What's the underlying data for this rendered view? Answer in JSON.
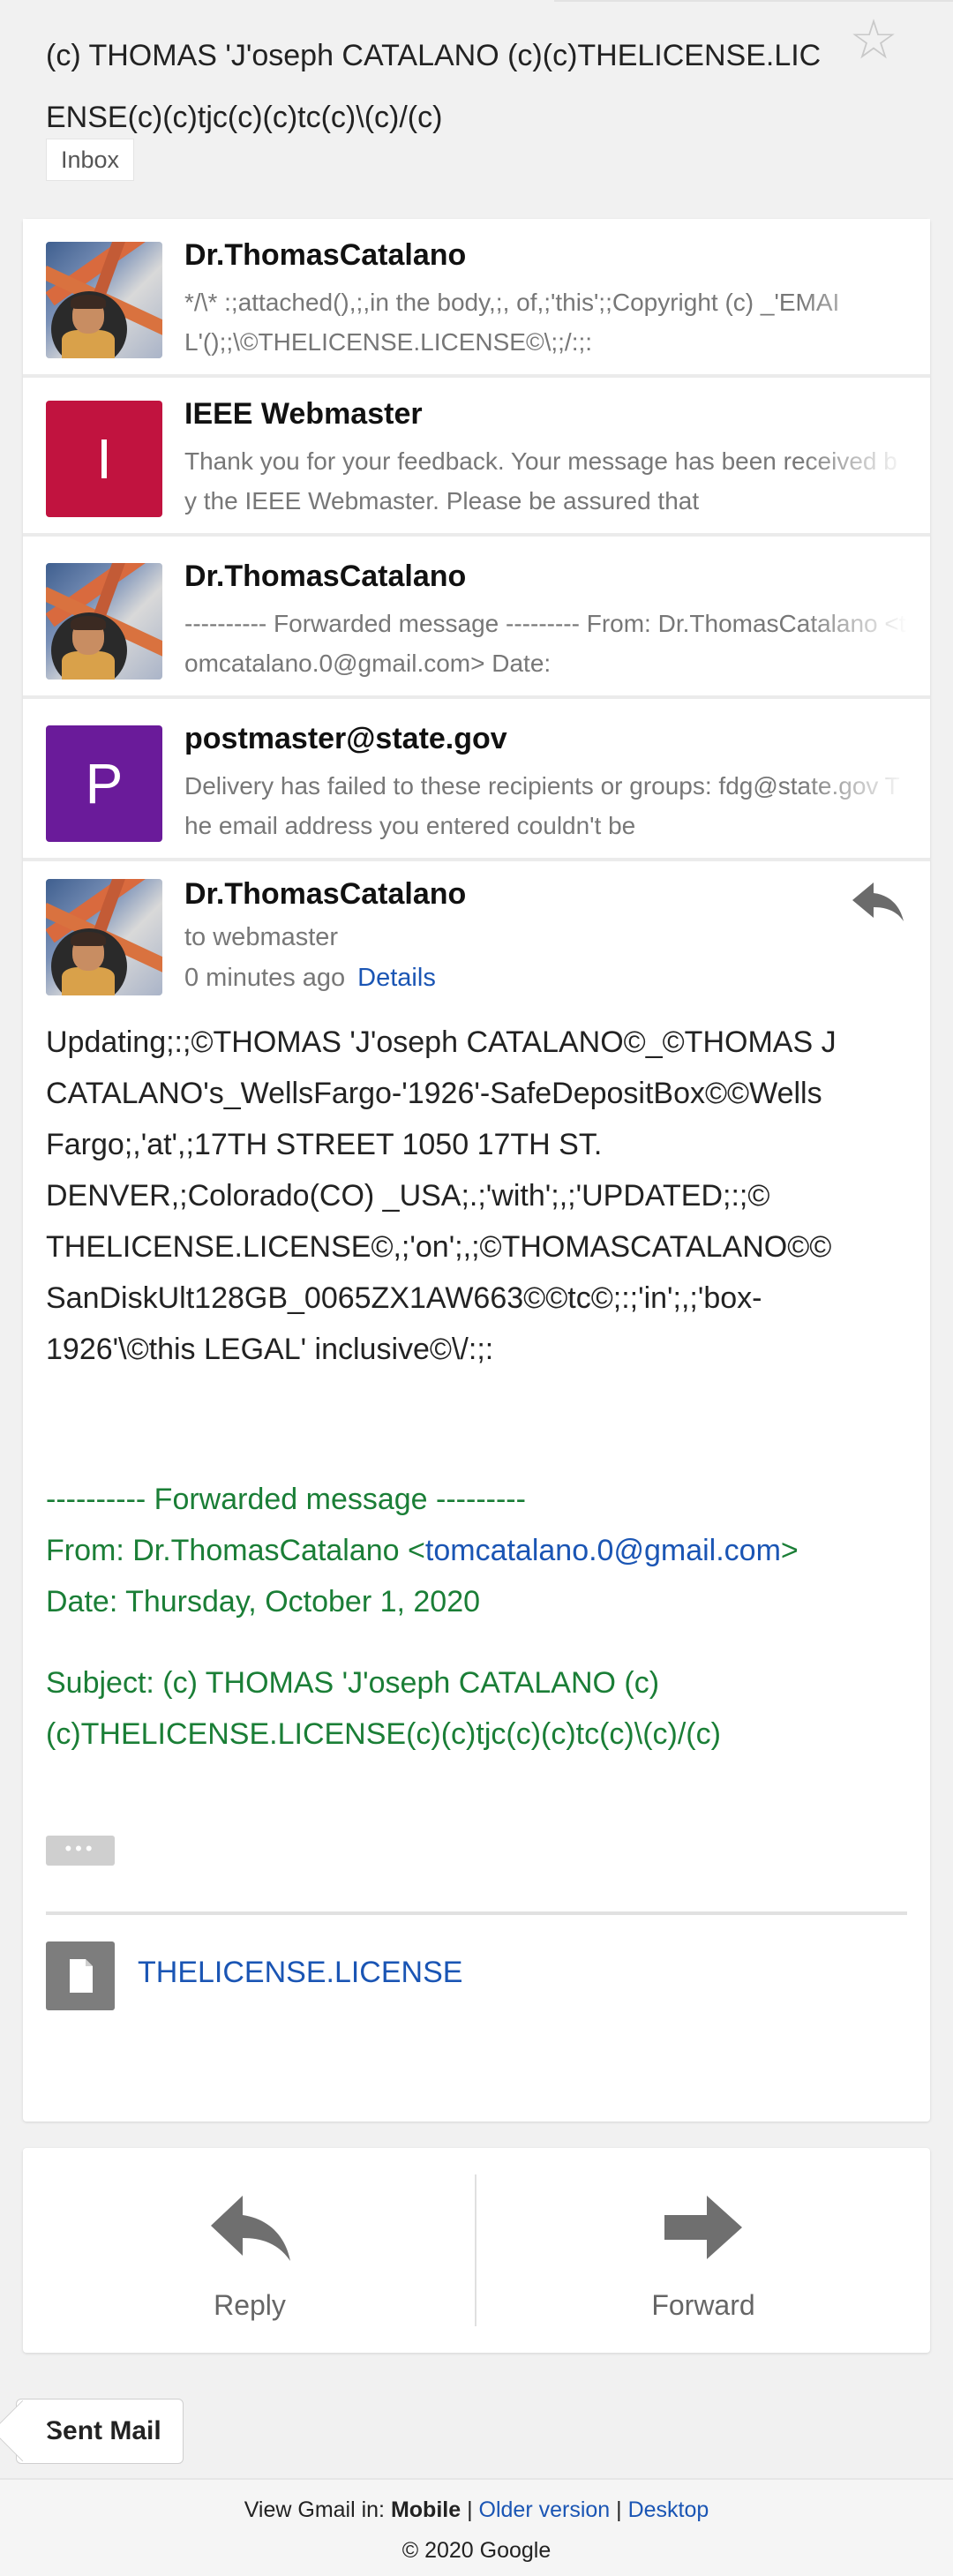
{
  "header": {
    "subject": "(c) THOMAS 'J'oseph CATALANO (c)(c)THELICENSE.LICENSE(c)(c)tjc(c)(c)tc(c)\\(c)/(c)",
    "label_chip": "Inbox",
    "star_icon": "star-outline-icon"
  },
  "thread": [
    {
      "sender": "Dr.ThomasCatalano",
      "avatar": "photo",
      "snippet": "*/\\* :;attached(),;,in the body,;, of,;'this';;Copyright (c) _'EMAIL'();;\\©THELICENSE.LICENSE©\\;;/:;:"
    },
    {
      "sender": "IEEE Webmaster",
      "avatar": "letter",
      "avatar_letter": "I",
      "avatar_color": "#c1133f",
      "snippet": "Thank you for your feedback. Your message has been received by the IEEE Webmaster. Please be assured that"
    },
    {
      "sender": "Dr.ThomasCatalano",
      "avatar": "photo",
      "snippet": "---------- Forwarded message --------- From: Dr.ThomasCatalano <tomcatalano.0@gmail.com> Date:"
    },
    {
      "sender": "postmaster@state.gov",
      "avatar": "letter",
      "avatar_letter": "P",
      "avatar_color": "#6a1b9a",
      "snippet": "Delivery has failed to these recipients or groups: fdg@state.gov The email address you entered couldn't be"
    }
  ],
  "open_message": {
    "sender": "Dr.ThomasCatalano",
    "to": "to webmaster",
    "time": "0 minutes ago",
    "details_link": "Details",
    "body": "Updating;:;©THOMAS 'J'oseph CATALANO©_©THOMAS J CATALANO's_WellsFargo-'1926'-SafeDepositBox©©Wells Fargo;,'at',;17TH STREET 1050 17TH ST. DENVER,;Colorado(CO) _USA;.;'with';,;'UPDATED;:;© THELICENSE.LICENSE©,;'on';,;©THOMASCATALANO©© SanDiskUlt128GB_0065ZX1AW663©©tc©;:;'in';,;'box-1926'\\©this LEGAL' inclusive©\\/:;:",
    "forwarded": {
      "marker": "---------- Forwarded message ---------",
      "from_label": "From: Dr.ThomasCatalano <",
      "from_email": "tomcatalano.0@gmail.com",
      "from_close": ">",
      "date": "Date: Thursday, October 1, 2020",
      "subject": "Subject: (c) THOMAS 'J'oseph CATALANO (c)(c)THELICENSE.LICENSE(c)(c)tjc(c)(c)tc(c)\\(c)/(c)"
    },
    "ellipsis": "•••",
    "attachment": "THELICENSE.LICENSE"
  },
  "actions": {
    "reply": "Reply",
    "forward": "Forward"
  },
  "nav": {
    "back_label": "Sent Mail"
  },
  "footer": {
    "view_in": "View Gmail in: ",
    "mobile": "Mobile",
    "sep1": " | ",
    "older": "Older version",
    "sep2": " | ",
    "desktop": "Desktop",
    "copyright": "© 2020 Google"
  }
}
